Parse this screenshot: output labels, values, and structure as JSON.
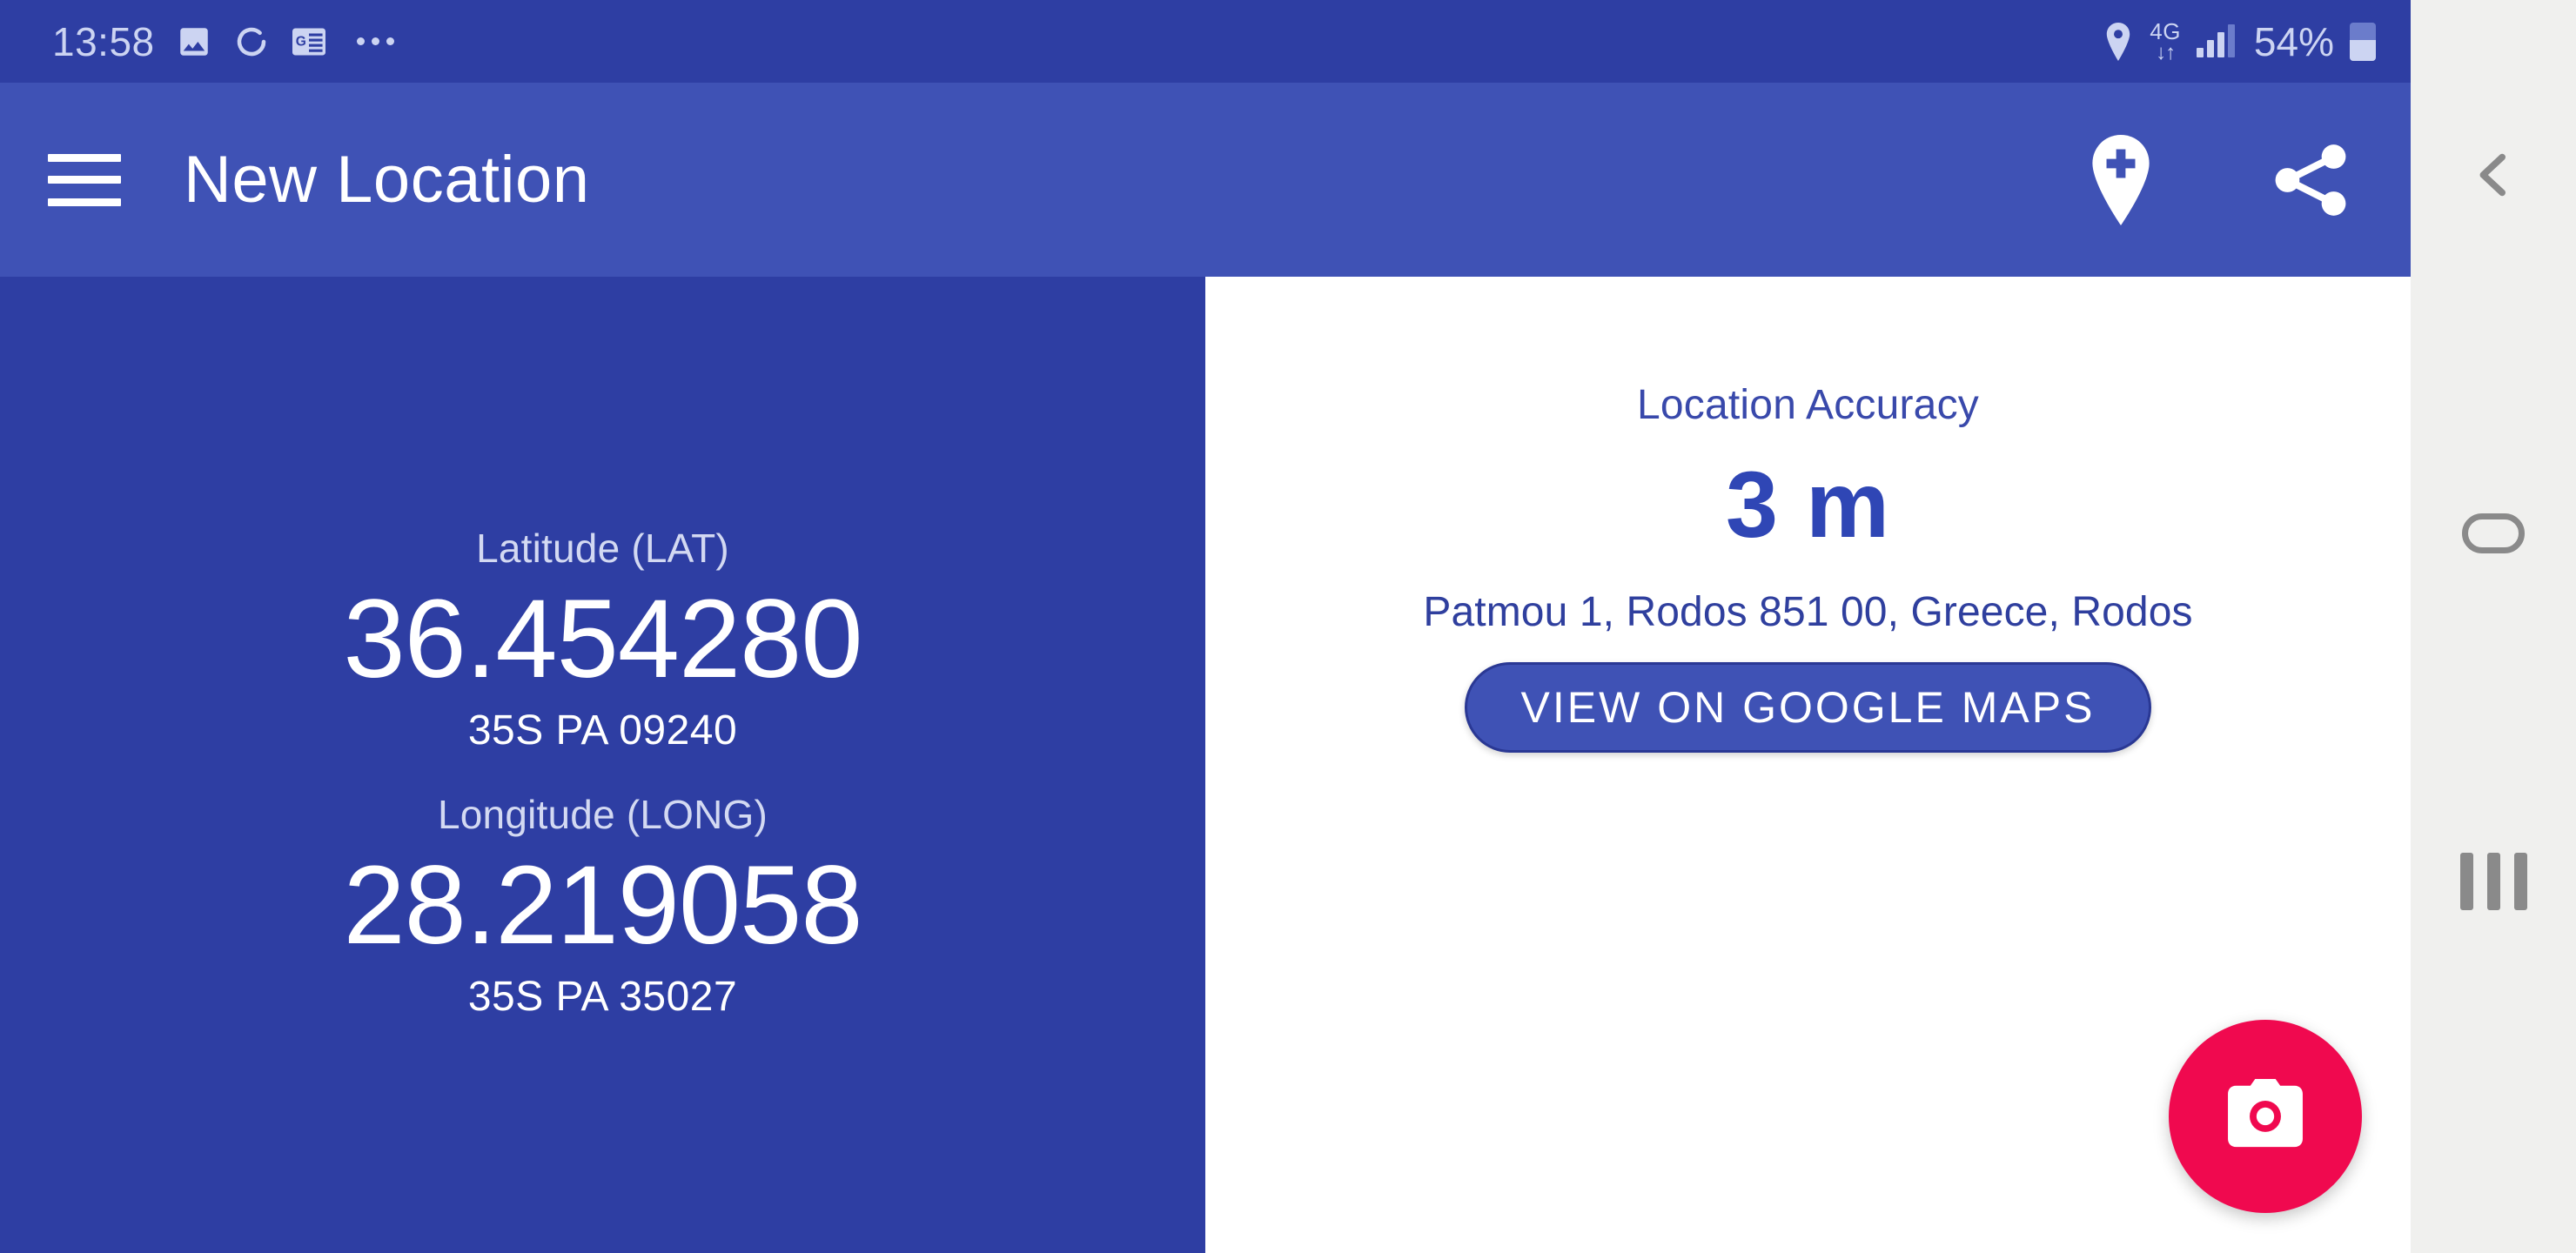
{
  "status_bar": {
    "time": "13:58",
    "battery_percent": "54%",
    "network_type": "4G",
    "icons": [
      "image-icon",
      "sync-icon",
      "google-news-icon",
      "more-dots-icon",
      "location-pin-icon",
      "data-transfer-icon",
      "signal-bars-icon",
      "battery-icon"
    ]
  },
  "app_bar": {
    "menu_icon": "hamburger-menu-icon",
    "title": "New Location",
    "add_location_icon": "add-location-pin-icon",
    "share_icon": "share-icon"
  },
  "location": {
    "latitude_label": "Latitude (LAT)",
    "latitude_value": "36.454280",
    "latitude_grid": "35S PA 09240",
    "longitude_label": "Longitude (LONG)",
    "longitude_value": "28.219058",
    "longitude_grid": "35S PA 35027"
  },
  "accuracy": {
    "label": "Location Accuracy",
    "value": "3 m"
  },
  "address": "Patmou 1, Rodos 851 00, Greece, Rodos",
  "maps_button": "VIEW ON GOOGLE MAPS",
  "fab": {
    "icon": "camera-icon"
  },
  "nav_bar": {
    "back": "back-chevron-icon",
    "home": "home-pill-icon",
    "recents": "recents-icon"
  },
  "colors": {
    "status_bar": "#2E3EA3",
    "app_bar": "#3F52B5",
    "left_panel": "#2E3EA3",
    "accent_blue": "#2F46B5",
    "fab_pink": "#F0094F",
    "nav_bar": "#F0F0EE"
  }
}
